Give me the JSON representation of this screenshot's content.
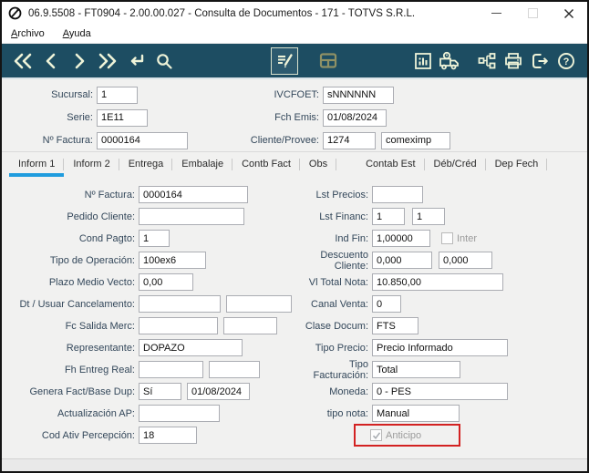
{
  "window": {
    "title": "06.9.5508 - FT0904 - 2.00.00.027 - Consulta de Documentos - 171 - TOTVS S.R.L."
  },
  "menu": {
    "items": [
      "Archivo",
      "Ayuda"
    ]
  },
  "toolbar": {
    "icons": [
      "nav-first",
      "nav-previous",
      "nav-next",
      "nav-last",
      "enter-confirm",
      "search",
      "edit-document",
      "browse-table",
      "chart",
      "delivery-tracking",
      "org-tree",
      "print",
      "exit",
      "help"
    ]
  },
  "header": {
    "fields": [
      {
        "label": "Sucursal:",
        "value": "1"
      },
      {
        "label": "Serie:",
        "value": "1E11"
      },
      {
        "label": "Nº Factura:",
        "value": "0000164"
      },
      {
        "label": "IVCFOET:",
        "value": "sNNNNNN"
      },
      {
        "label": "Fch Emis:",
        "value": "01/08/2024"
      },
      {
        "label": "Cliente/Provee:",
        "value": "1274",
        "value2": "comeximp"
      }
    ]
  },
  "tabs": [
    "Inform 1",
    "Inform 2",
    "Entrega",
    "Embalaje",
    "Contb Fact",
    "Obs",
    "Contab Est",
    "Déb/Créd",
    "Dep Fech"
  ],
  "active_tab": "Inform 1",
  "form": {
    "left": [
      {
        "label": "Nº Factura:",
        "v1": "0000164"
      },
      {
        "label": "Pedido Cliente:",
        "v1": ""
      },
      {
        "label": "Cond Pagto:",
        "v1": "1"
      },
      {
        "label": "Tipo de Operación:",
        "v1": "100ex6"
      },
      {
        "label": "Plazo Medio Vecto:",
        "v1": "0,00"
      },
      {
        "label": "Dt / Usuar Cancelamento:",
        "v1": "",
        "v2": ""
      },
      {
        "label": "Fc Salida Merc:",
        "v1": "",
        "v2": ""
      },
      {
        "label": "Representante:",
        "v1": "DOPAZO"
      },
      {
        "label": "Fh Entreg Real:",
        "v1": "",
        "v2": ""
      },
      {
        "label": "Genera Fact/Base Dup:",
        "v1": "Sí",
        "v2": "01/08/2024"
      },
      {
        "label": "Actualización AP:",
        "v1": ""
      },
      {
        "label": "Cod Ativ Percepción:",
        "v1": "18"
      }
    ],
    "right": [
      {
        "label": "Lst Precios:",
        "v1": ""
      },
      {
        "label": "Lst Financ:",
        "v1": "1",
        "v2": "1"
      },
      {
        "label": "Ind Fin:",
        "v1": "1,00000",
        "checkbox": "Inter",
        "checkbox_checked": false
      },
      {
        "label": "Descuento Cliente:",
        "v1": "0,000",
        "v2": "0,000"
      },
      {
        "label": "Vl Total Nota:",
        "v1": "10.850,00"
      },
      {
        "label": "Canal Venta:",
        "v1": "0"
      },
      {
        "label": "Clase Docum:",
        "v1": "FTS"
      },
      {
        "label": "Tipo Precio:",
        "v1": "Precio Informado"
      },
      {
        "label": "Tipo Facturación:",
        "v1": "Total"
      },
      {
        "label": "Moneda:",
        "v1": "0 - PES"
      },
      {
        "label": "tipo nota:",
        "v1": "Manual"
      }
    ],
    "anticipo": {
      "label": "Anticipo",
      "checked": true,
      "highlighted": true
    }
  },
  "colors": {
    "toolbar_bg": "#1d4d62",
    "toolbar_icon": "#eef3d8",
    "browse_icon_khaki": "#8f9165",
    "tab_active_underline": "#1f9cde",
    "highlight_red": "#d32222"
  }
}
